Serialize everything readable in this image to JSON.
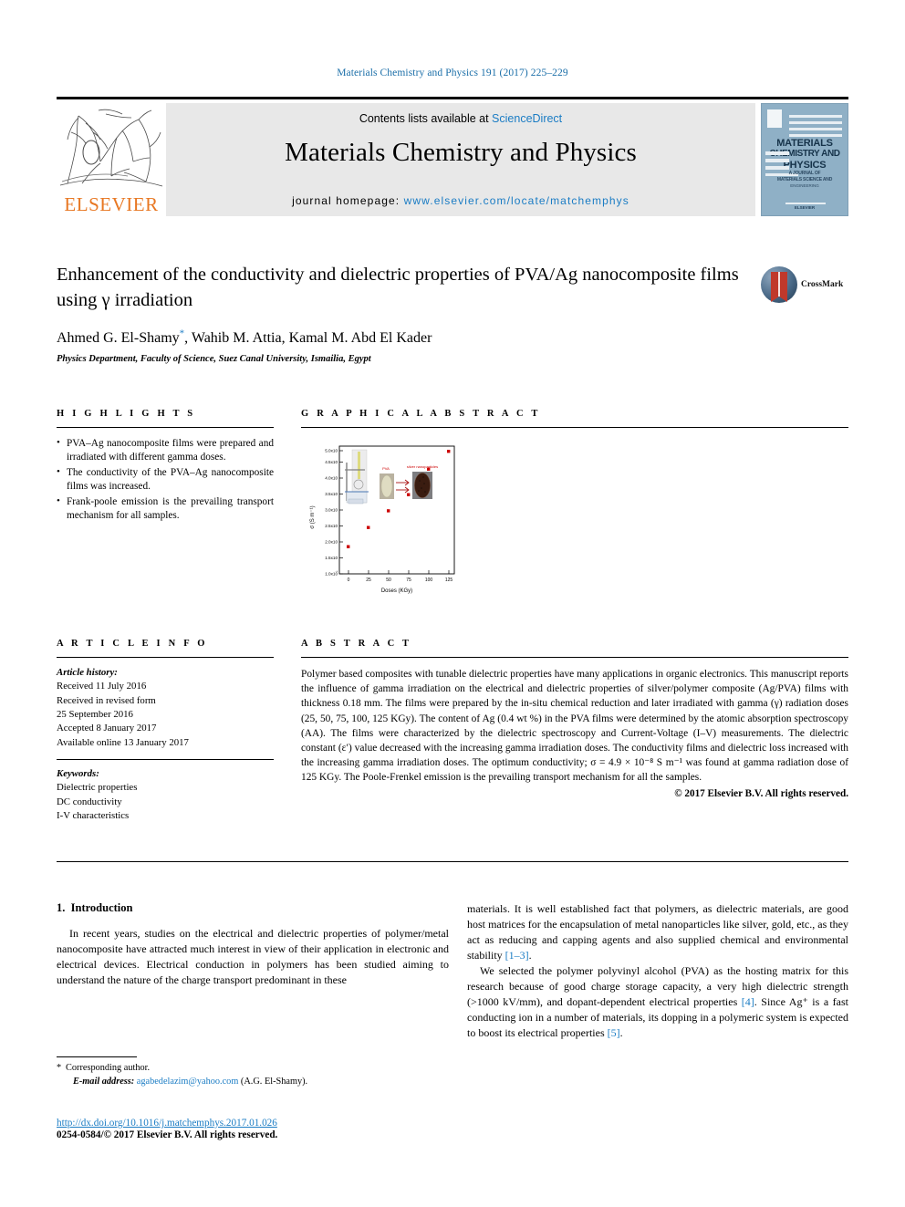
{
  "running_head": "Materials Chemistry and Physics 191 (2017) 225–229",
  "masthead": {
    "publisher": "ELSEVIER",
    "contents_prefix": "Contents lists available at ",
    "contents_link": "ScienceDirect",
    "journal_title": "Materials Chemistry and Physics",
    "homepage_label": "journal homepage: ",
    "homepage_url": "www.elsevier.com/locate/matchemphys",
    "cover": {
      "line1": "MATERIALS",
      "line2": "CHEMISTRY AND",
      "line3": "PHYSICS",
      "sub1": "A JOURNAL OF",
      "sub2": "MATERIALS SCIENCE AND",
      "sub3": "ENGINEERING",
      "bg_color": "#8fb0c6"
    }
  },
  "article": {
    "title": "Enhancement of the conductivity and dielectric properties of PVA/Ag nanocomposite films using γ irradiation",
    "authors": "Ahmed G. El-Shamy, Wahib M. Attia, Kamal M. Abd El Kader",
    "author_marker": "*",
    "affiliation": "Physics Department, Faculty of Science, Suez Canal University, Ismailia, Egypt",
    "crossmark_label": "CrossMark"
  },
  "highlights": {
    "heading": "H I G H L I G H T S",
    "items": [
      "PVA–Ag nanocomposite films were prepared and irradiated with different gamma doses.",
      "The conductivity of the PVA–Ag nanocomposite films was increased.",
      "Frank-poole emission is the prevailing transport mechanism for all samples."
    ]
  },
  "graphical_abstract": {
    "heading": "G R A P H I C A L   A B S T R A C T"
  },
  "chart_data": {
    "type": "scatter",
    "title": "",
    "xlabel": "Doses (KGy)",
    "ylabel": "σ (S m⁻¹)",
    "x": [
      0,
      25,
      50,
      75,
      100,
      125
    ],
    "y": [
      1.9,
      2.5,
      3.05,
      3.55,
      4.35,
      4.9
    ],
    "y_unit": "×10⁻⁸",
    "xticks": [
      "0",
      "25",
      "50",
      "75",
      "100",
      "125"
    ],
    "yticks": [
      "1.0x10⁻⁸",
      "1.5x10⁻⁸",
      "2.0x10⁻⁸",
      "2.5x10⁻⁸",
      "3.0x10⁻⁸",
      "3.5x10⁻⁸",
      "4.0x10⁻⁸",
      "4.5x10⁻⁸",
      "5.0x10⁻⁸"
    ],
    "xlim": [
      -12,
      140
    ],
    "ylim": [
      1.0,
      5.2
    ],
    "marker_color": "#cc0000",
    "grid": false,
    "legend": "none",
    "annotations": [
      "PVA",
      "silver nanoparticles"
    ]
  },
  "article_info": {
    "heading": "A R T I C L E   I N F O",
    "history_label": "Article history:",
    "history": [
      "Received 11 July 2016",
      "Received in revised form",
      "25 September 2016",
      "Accepted 8 January 2017",
      "Available online 13 January 2017"
    ],
    "keywords_label": "Keywords:",
    "keywords": [
      "Dielectric properties",
      "DC conductivity",
      "I-V characteristics"
    ]
  },
  "abstract": {
    "heading": "A B S T R A C T",
    "text": "Polymer based composites with tunable dielectric properties have many applications in organic electronics. This manuscript reports the influence of gamma irradiation on the electrical and dielectric properties of silver/polymer composite (Ag/PVA) films with thickness 0.18 mm. The films were prepared by the in-situ chemical reduction and later irradiated with gamma (γ) radiation doses (25, 50, 75, 100, 125 KGy). The content of Ag (0.4 wt %) in the PVA films were determined by the atomic absorption spectroscopy (AA). The films were characterized by the dielectric spectroscopy and Current-Voltage (I–V) measurements. The dielectric constant (ε′) value decreased with the increasing gamma irradiation doses. The conductivity films and dielectric loss increased with the increasing gamma irradiation doses. The optimum conductivity; σ = 4.9 × 10⁻⁸ S m⁻¹ was found at gamma radiation dose of 125 KGy. The Poole-Frenkel emission is the prevailing transport mechanism for all the samples.",
    "copyright": "© 2017 Elsevier B.V. All rights reserved."
  },
  "intro": {
    "section_number": "1.",
    "section_title": "Introduction",
    "para1": "In recent years, studies on the electrical and dielectric properties of polymer/metal nanocomposite have attracted much interest in view of their application in electronic and electrical devices. Electrical conduction in polymers has been studied aiming to understand the nature of the charge transport predominant in these",
    "para2_a": "materials. It is well established fact that polymers, as dielectric materials, are good host matrices for the encapsulation of metal nanoparticles like silver, gold, etc., as they act as reducing and capping agents and also supplied chemical and environmental stability ",
    "para2_ref": "[1–3]",
    "para2_b": ".",
    "para3_a": "We selected the polymer polyvinyl alcohol (PVA) as the hosting matrix for this research because of good charge storage capacity, a very high dielectric strength (>1000 kV/mm), and dopant-dependent electrical properties ",
    "para3_ref1": "[4]",
    "para3_b": ". Since Ag⁺ is a fast conducting ion in a number of materials, its dopping in a polymeric system is expected to boost its electrical properties ",
    "para3_ref2": "[5]",
    "para3_c": "."
  },
  "footer": {
    "corresponding_marker": "*",
    "corresponding_label": "Corresponding author.",
    "email_label": "E-mail address:",
    "email": "agabedelazim@yahoo.com",
    "email_owner": "(A.G. El-Shamy).",
    "doi": "http://dx.doi.org/10.1016/j.matchemphys.2017.01.026",
    "issn": "0254-0584/© 2017 Elsevier B.V. All rights reserved."
  },
  "colors": {
    "link": "#1a7cc4",
    "elsevier_orange": "#e87722",
    "marker_red": "#cc0000"
  }
}
